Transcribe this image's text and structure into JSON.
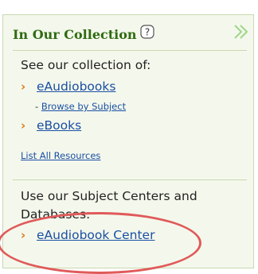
{
  "header": {
    "title": "In Our Collection",
    "help_icon": "help-question-icon",
    "expand_icon": "double-chevron-right-icon"
  },
  "collection": {
    "intro": "See our collection of:",
    "items": [
      {
        "label": "eAudiobooks",
        "sub_prefix": "- ",
        "sub_link": "Browse by Subject"
      },
      {
        "label": "eBooks"
      }
    ],
    "list_all": "List All Resources"
  },
  "subject_centers": {
    "intro_line1": "Use our Subject Centers and",
    "intro_line2": "Databases:",
    "items": [
      {
        "label": "eAudiobook Center"
      }
    ]
  },
  "colors": {
    "panel_bg": "#f4f8ec",
    "title": "#2f6b12",
    "link": "#1a4fa3",
    "bullet": "#e07b1a",
    "highlight": "#e05a5a"
  }
}
